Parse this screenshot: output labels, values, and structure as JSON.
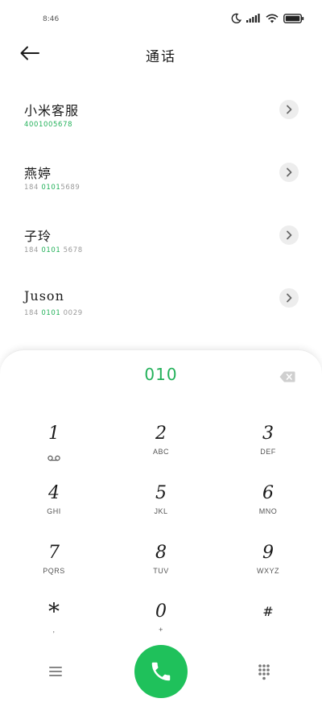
{
  "status_bar": {
    "time": "8:46",
    "icons": [
      "moon-icon",
      "signal-icon",
      "wifi-icon",
      "battery-icon"
    ]
  },
  "header": {
    "title": "通话",
    "back_icon": "arrow-left-icon"
  },
  "contacts": [
    {
      "name": "小米客服",
      "number_prefix": "",
      "number_match": "4001005678",
      "number_suffix": "",
      "all_green": true
    },
    {
      "name": "燕婷",
      "number_prefix": "184 ",
      "number_match": "0101",
      "number_suffix": "5689",
      "all_green": false
    },
    {
      "name": "子玲",
      "number_prefix": "184 ",
      "number_match": "0101",
      "number_suffix": " 5678",
      "all_green": false
    },
    {
      "name": "Juson",
      "number_prefix": "184 ",
      "number_match": "0101",
      "number_suffix": " 0029",
      "all_green": false
    }
  ],
  "dialer": {
    "input_value": "010",
    "keys": [
      {
        "digit": "1",
        "letters": ""
      },
      {
        "digit": "2",
        "letters": "ABC"
      },
      {
        "digit": "3",
        "letters": "DEF"
      },
      {
        "digit": "4",
        "letters": "GHI"
      },
      {
        "digit": "5",
        "letters": "JKL"
      },
      {
        "digit": "6",
        "letters": "MNO"
      },
      {
        "digit": "7",
        "letters": "PQRS"
      },
      {
        "digit": "8",
        "letters": "TUV"
      },
      {
        "digit": "9",
        "letters": "WXYZ"
      },
      {
        "digit": "*",
        "letters": ","
      },
      {
        "digit": "0",
        "letters": "+"
      },
      {
        "digit": "#",
        "letters": ""
      }
    ]
  },
  "colors": {
    "accent_green": "#23b15a",
    "call_button": "#1fc15b"
  }
}
